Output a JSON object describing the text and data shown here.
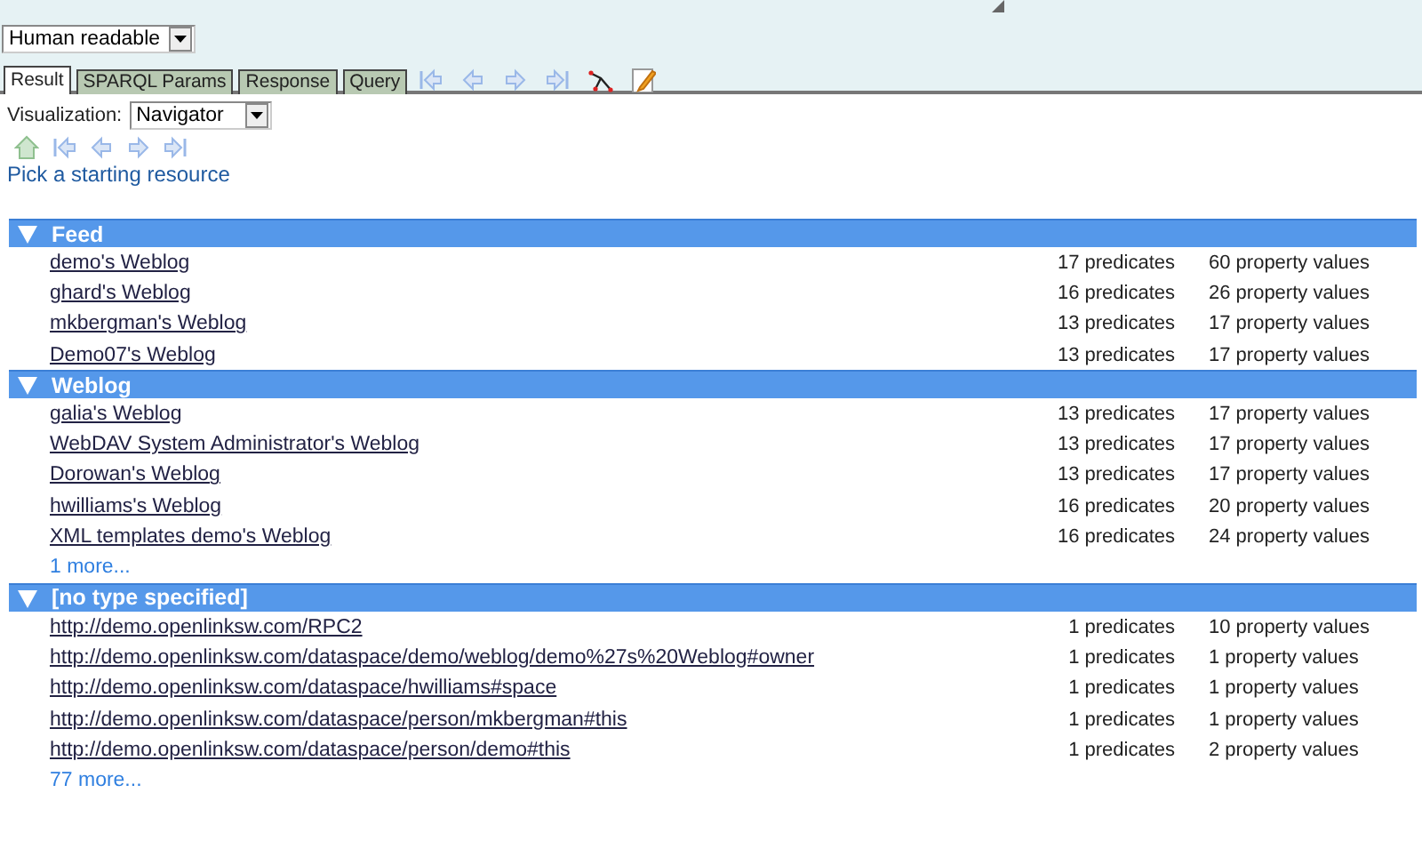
{
  "format_select": {
    "value": "Human readable"
  },
  "tabs": [
    {
      "label": "Result",
      "selected": true
    },
    {
      "label": "SPARQL Params",
      "selected": false
    },
    {
      "label": "Response",
      "selected": false
    },
    {
      "label": "Query",
      "selected": false
    }
  ],
  "visualization": {
    "label": "Visualization:",
    "value": "Navigator"
  },
  "start_link": "Pick a starting resource",
  "groups": [
    {
      "title": "Feed",
      "expanded": true,
      "items": [
        {
          "label": "demo's Weblog",
          "predicates": "17 predicates",
          "values": "60 property values"
        },
        {
          "label": "ghard's Weblog",
          "predicates": "16 predicates",
          "values": "26 property values"
        },
        {
          "label": "mkbergman's Weblog",
          "predicates": "13 predicates",
          "values": "17 property values"
        },
        {
          "label": "Demo07's Weblog",
          "predicates": "13 predicates",
          "values": "17 property values"
        }
      ]
    },
    {
      "title": "Weblog",
      "expanded": true,
      "items": [
        {
          "label": "galia's Weblog",
          "predicates": "13 predicates",
          "values": "17 property values"
        },
        {
          "label": "WebDAV System Administrator's Weblog",
          "predicates": "13 predicates",
          "values": "17 property values"
        },
        {
          "label": "Dorowan's Weblog",
          "predicates": "13 predicates",
          "values": "17 property values"
        },
        {
          "label": "hwilliams's Weblog",
          "predicates": "16 predicates",
          "values": "20 property values"
        },
        {
          "label": "XML templates demo's Weblog",
          "predicates": "16 predicates",
          "values": "24 property values"
        }
      ],
      "more": "1 more..."
    },
    {
      "title": "[no type specified]",
      "expanded": true,
      "items": [
        {
          "label": "http://demo.openlinksw.com/RPC2",
          "predicates": "1 predicates",
          "values": "10 property values"
        },
        {
          "label": "http://demo.openlinksw.com/dataspace/demo/weblog/demo%27s%20Weblog#owner",
          "predicates": "1 predicates",
          "values": "1 property values"
        },
        {
          "label": "http://demo.openlinksw.com/dataspace/hwilliams#space",
          "predicates": "1 predicates",
          "values": "1 property values"
        },
        {
          "label": "http://demo.openlinksw.com/dataspace/person/mkbergman#this",
          "predicates": "1 predicates",
          "values": "1 property values"
        },
        {
          "label": "http://demo.openlinksw.com/dataspace/person/demo#this",
          "predicates": "1 predicates",
          "values": "2 property values"
        }
      ],
      "more": "77 more..."
    }
  ]
}
